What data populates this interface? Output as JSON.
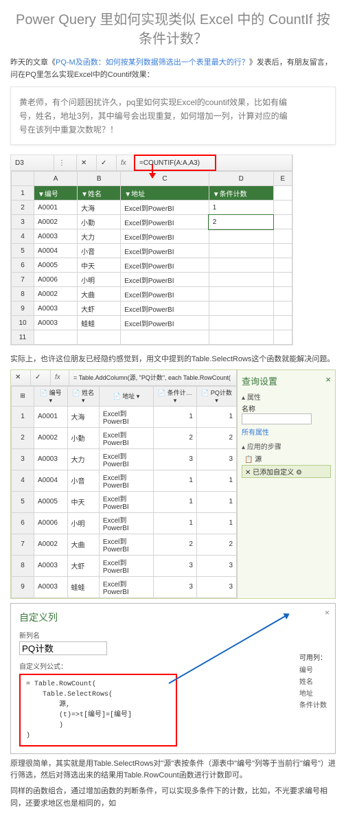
{
  "title": "Power Query 里如何实现类似 Excel 中的 CountIf 按条件计数？",
  "intro_a": "昨天的文章《",
  "intro_link": "PQ-M及函数：如何按某列数据筛选出一个表里最大的行？",
  "intro_b": "》发表后，有朋友留言，问在PQ里怎么实现Excel中的Countif效果：",
  "q": {
    "l1": "黄老师，有个问题困扰许久，pq里如何实现Excel的countif效果，比如有编",
    "l2": "号，姓名，地址3列，其中编号会出现重复，如何增加一列，计算对应的编",
    "l3": "号在该列中重复次数呢？！"
  },
  "excel": {
    "nameBox": "D3",
    "formula": "=COUNTIF(A:A,A3)",
    "cols": [
      "",
      "A",
      "B",
      "C",
      "D",
      "E"
    ],
    "headers": [
      "编号",
      "姓名",
      "地址",
      "条件计数"
    ],
    "rows": [
      [
        "2",
        "A0001",
        "大海",
        "Excel到PowerBI",
        "1",
        ""
      ],
      [
        "3",
        "A0002",
        "小勤",
        "Excel到PowerBI",
        "2",
        "",
        true
      ],
      [
        "4",
        "A0003",
        "大力",
        "Excel到PowerBI",
        "",
        ""
      ],
      [
        "5",
        "A0004",
        "小音",
        "Excel到PowerBI",
        "",
        ""
      ],
      [
        "6",
        "A0005",
        "中天",
        "Excel到PowerBI",
        "",
        ""
      ],
      [
        "7",
        "A0006",
        "小明",
        "Excel到PowerBI",
        "",
        ""
      ],
      [
        "8",
        "A0002",
        "大曲",
        "Excel到PowerBI",
        "",
        ""
      ],
      [
        "9",
        "A0003",
        "大虾",
        "Excel到PowerBI",
        "",
        ""
      ],
      [
        "10",
        "A0003",
        "蛙蛙",
        "Excel到PowerBI",
        "",
        ""
      ],
      [
        "11",
        "",
        "",
        "",
        "",
        ""
      ]
    ]
  },
  "mid": "实际上，也许这位朋友已经隐约感觉到，用文中提到的Table.SelectRows这个函数就能解决问题。",
  "pq": {
    "formula": "= Table.AddColumn(源, \"PQ计数\", each Table.RowCount(",
    "cols": [
      "",
      "编号",
      "姓名",
      "地址",
      "条件计…",
      "PQ计数"
    ],
    "rows": [
      [
        "1",
        "A0001",
        "大海",
        "Excel到PowerBI",
        "1",
        "1"
      ],
      [
        "2",
        "A0002",
        "小勤",
        "Excel到PowerBI",
        "2",
        "2"
      ],
      [
        "3",
        "A0003",
        "大力",
        "Excel到PowerBI",
        "3",
        "3"
      ],
      [
        "4",
        "A0004",
        "小音",
        "Excel到PowerBI",
        "1",
        "1"
      ],
      [
        "5",
        "A0005",
        "中天",
        "Excel到PowerBI",
        "1",
        "1"
      ],
      [
        "6",
        "A0006",
        "小明",
        "Excel到PowerBI",
        "1",
        "1"
      ],
      [
        "7",
        "A0002",
        "大曲",
        "Excel到PowerBI",
        "2",
        "2"
      ],
      [
        "8",
        "A0003",
        "大虾",
        "Excel到PowerBI",
        "3",
        "3"
      ],
      [
        "9",
        "A0003",
        "蛙蛙",
        "Excel到PowerBI",
        "3",
        "3"
      ]
    ],
    "panel": {
      "title": "查询设置",
      "attr": "属性",
      "name": "名称",
      "nameVal": "",
      "allAttr": "所有属性",
      "steps": "应用的步骤",
      "s1": "源",
      "s2": "已添加自定义"
    }
  },
  "custom": {
    "title": "自定义列",
    "newCol": "新列名",
    "colVal": "PQ计数",
    "formulaLbl": "自定义列公式：",
    "code": [
      "= Table.RowCount(",
      "    Table.SelectRows(",
      "        源,",
      "        (t)=>t[编号]=[编号]",
      "        )",
      ")"
    ],
    "avail": "可用列：",
    "fields": [
      "编号",
      "姓名",
      "地址",
      "条件计数"
    ]
  },
  "p1": "原理很简单，其实就是用Table.SelectRows对\"源\"表按条件（源表中\"编号\"列等于当前行\"编号\"）进行筛选，然后对筛选出来的结果用Table.RowCount函数进行计数即可。",
  "p2": "同样的函数组合，通过增加函数的判断条件，可以实现多条件下的计数，比如，不光要求编号相同，还要求地区也是相同的，如"
}
